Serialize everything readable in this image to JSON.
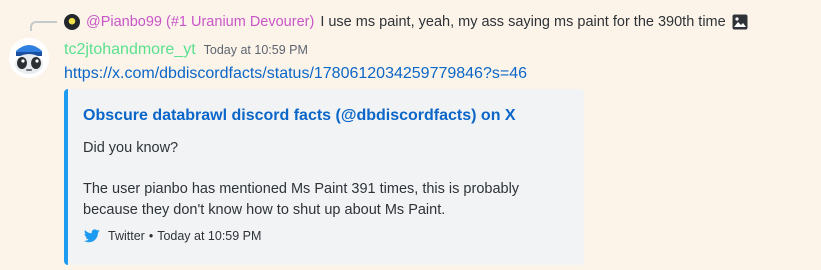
{
  "reply": {
    "author": "@Pianbo99 (#1 Uranium Devourer)",
    "content": "I use ms paint, yeah, my ass saying ms paint for the 390th time",
    "attachment_icon": "image-icon"
  },
  "message": {
    "username": "tc2jtohandmore_yt",
    "timestamp": "Today at 10:59 PM",
    "link": "https://x.com/dbdiscordfacts/status/1780612034259779846?s=46",
    "avatar_icon": "robot-avatar"
  },
  "embed": {
    "title": "Obscure databrawl discord facts (@dbdiscordfacts) on X",
    "description_lines": [
      "Did you know?",
      "",
      "The user pianbo has mentioned Ms Paint 391 times, this is probably",
      "because they don't know how to shut up about Ms Paint."
    ],
    "provider": "Twitter",
    "separator": "•",
    "footer_time": "Today at 10:59 PM",
    "provider_icon": "twitter-icon",
    "accent_color": "#1d9bf0"
  },
  "colors": {
    "background": "#fdf4e9",
    "reply_author": "#c955c9",
    "username": "#5ae08f",
    "link": "#0a66c8"
  }
}
